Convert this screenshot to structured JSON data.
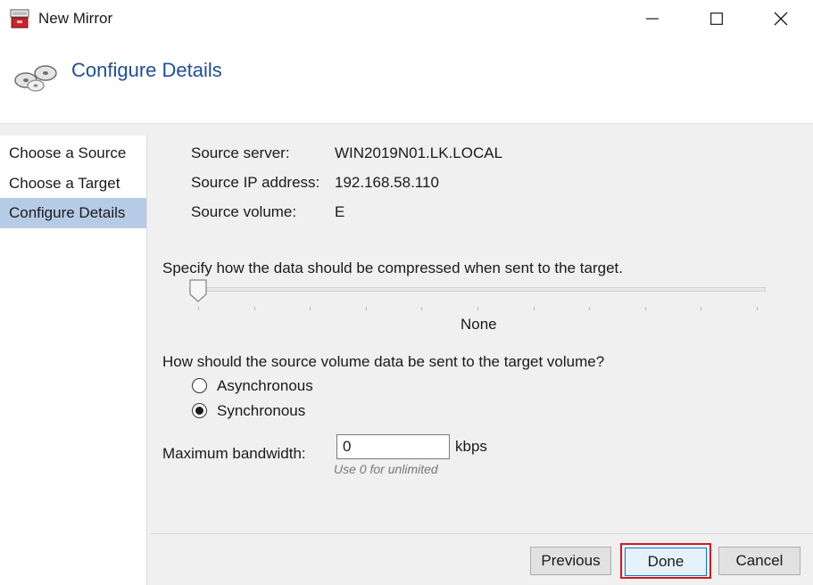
{
  "window": {
    "title": "New Mirror"
  },
  "header": {
    "title": "Configure Details"
  },
  "sidebar": {
    "items": [
      {
        "label": "Choose a Source",
        "selected": false
      },
      {
        "label": "Choose a Target",
        "selected": false
      },
      {
        "label": "Configure Details",
        "selected": true
      }
    ]
  },
  "source": {
    "server_label": "Source server:",
    "server_value": "WIN2019N01.LK.LOCAL",
    "ip_label": "Source IP address:",
    "ip_value": "192.168.58.110",
    "volume_label": "Source volume:",
    "volume_value": "E"
  },
  "compression": {
    "label": "Specify how the data should be compressed when sent to the target.",
    "value_text": "None",
    "level_index": 0,
    "tick_count": 11
  },
  "transfer": {
    "label": "How should the source volume data be sent to the target volume?",
    "options": [
      {
        "label": "Asynchronous",
        "checked": false
      },
      {
        "label": "Synchronous",
        "checked": true
      }
    ]
  },
  "bandwidth": {
    "label": "Maximum bandwidth:",
    "value": "0",
    "unit": "kbps",
    "hint": "Use 0 for unlimited"
  },
  "footer": {
    "previous_label": "Previous",
    "done_label": "Done",
    "cancel_label": "Cancel"
  },
  "colors": {
    "header_title": "#1f4e9c",
    "selected_nav": "#b6cbe6",
    "highlight_border": "#d0181f"
  }
}
